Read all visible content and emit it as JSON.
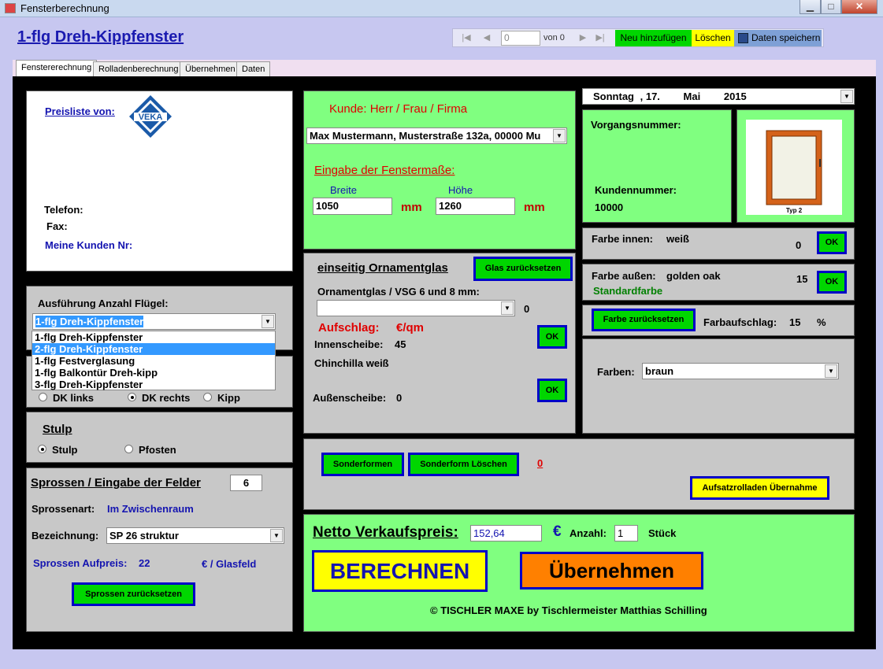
{
  "window": {
    "title": "Fensterberechnung",
    "min": "▁",
    "max": "□",
    "close": "✕"
  },
  "header": {
    "form_title": "1-flg Dreh-Kippfenster"
  },
  "navigator": {
    "first": "|◀",
    "prev": "◀",
    "position": "0",
    "of_label": "von 0",
    "next": "▶",
    "last": "▶|",
    "add": "Neu hinzufügen",
    "delete": "Löschen",
    "save": "Daten speichern"
  },
  "tabs": [
    "Fenstererechnung",
    "Rolladenberechnung",
    "Übernehmen",
    "Daten"
  ],
  "price_list": {
    "label": "Preisliste von:",
    "logo": "VEKA",
    "telefon": "Telefon:",
    "fax": "Fax:",
    "kunden_nr": "Meine Kunden Nr:"
  },
  "ausfuehrung": {
    "label": "Ausführung Anzahl Flügel:",
    "selected": "1-flg Dreh-Kippfenster",
    "options": [
      "1-flg Dreh-Kippfenster",
      "2-flg Dreh-Kippfenster",
      "1-flg Festverglasung",
      "1-flg Balkontür Dreh-kipp",
      "3-flg Dreh-Kippfenster"
    ],
    "highlighted_index": 1
  },
  "opening": {
    "dk_links": "DK links",
    "dk_rechts": "DK rechts",
    "kipp": "Kipp",
    "selected": "DK rechts"
  },
  "stulp": {
    "title": "Stulp",
    "stulp": "Stulp",
    "pfosten": "Pfosten",
    "selected": "Stulp"
  },
  "sprossen": {
    "title": "Sprossen / Eingabe der Felder",
    "felder": "6",
    "art_label": "Sprossenart:",
    "art_value": "Im Zwischenraum",
    "bez_label": "Bezeichnung:",
    "bez_value": "SP 26 struktur",
    "aufpreis_label": "Sprossen Aufpreis:",
    "aufpreis_value": "22",
    "aufpreis_unit": "€ / Glasfeld",
    "reset": "Sprossen zurücksetzen"
  },
  "kunde": {
    "label": "Kunde: Herr / Frau / Firma",
    "selected": "Max Mustermann, Musterstraße 132a, 00000 Mu",
    "masse_label": "Eingabe der Fenstermaße:",
    "breite_label": "Breite",
    "breite": "1050",
    "hoehe_label": "Höhe",
    "hoehe": "1260",
    "unit": "mm"
  },
  "glas": {
    "title": "einseitig Ornamentglas",
    "reset": "Glas zurücksetzen",
    "orn_label": "Ornamentglas / VSG 6 und 8 mm:",
    "orn_value": "",
    "orn_count": "0",
    "aufschlag": "Aufschlag:",
    "aufschlag_unit": "€/qm",
    "innen_label": "Innenscheibe:",
    "innen_value": "45",
    "ok1": "OK",
    "chinchilla": "Chinchilla weiß",
    "aussen_label": "Außenscheibe:",
    "aussen_value": "0",
    "ok2": "OK"
  },
  "datum": {
    "day": "Sonntag",
    "date": ",  17.",
    "month": "Mai",
    "year": "2015"
  },
  "vorgang": {
    "label": "Vorgangsnummer:",
    "kunden_label": "Kundennummer:",
    "kunden_value": "10000",
    "typ": "Typ 2"
  },
  "farbe": {
    "innen_label": "Farbe innen:",
    "innen_value": "weiß",
    "innen_num": "0",
    "ok_innen": "OK",
    "aussen_label": "Farbe außen:",
    "aussen_value": "golden oak",
    "aussen_num": "15",
    "ok_aussen": "OK",
    "standard": "Standardfarbe",
    "reset": "Farbe zurücksetzen",
    "aufschlag_label": "Farbaufschlag:",
    "aufschlag_value": "15",
    "aufschlag_unit": "%",
    "farben_label": "Farben:",
    "farben_value": "braun"
  },
  "sonder": {
    "btn1": "Sonderformen",
    "btn2": "Sonderform Löschen",
    "count": "0",
    "rolladen": "Aufsatzrolladen Übernahme"
  },
  "preis": {
    "label": "Netto Verkaufspreis:",
    "value": "152,64",
    "currency": "€",
    "anzahl_label": "Anzahl:",
    "anzahl": "1",
    "stueck": "Stück",
    "berechnen": "BERECHNEN",
    "uebernehmen": "Übernehmen",
    "copyright": "© TISCHLER MAXE  by Tischlermeister Matthias Schilling"
  },
  "colors": {
    "bg": "#c7c7f0",
    "panel_green": "#80ff80",
    "panel_grey": "#c8c8c8",
    "accent_blue": "#0000c8",
    "btn_green": "#00d600",
    "btn_yellow": "#ffff00",
    "uebernehmen_orange": "#ff8000"
  }
}
